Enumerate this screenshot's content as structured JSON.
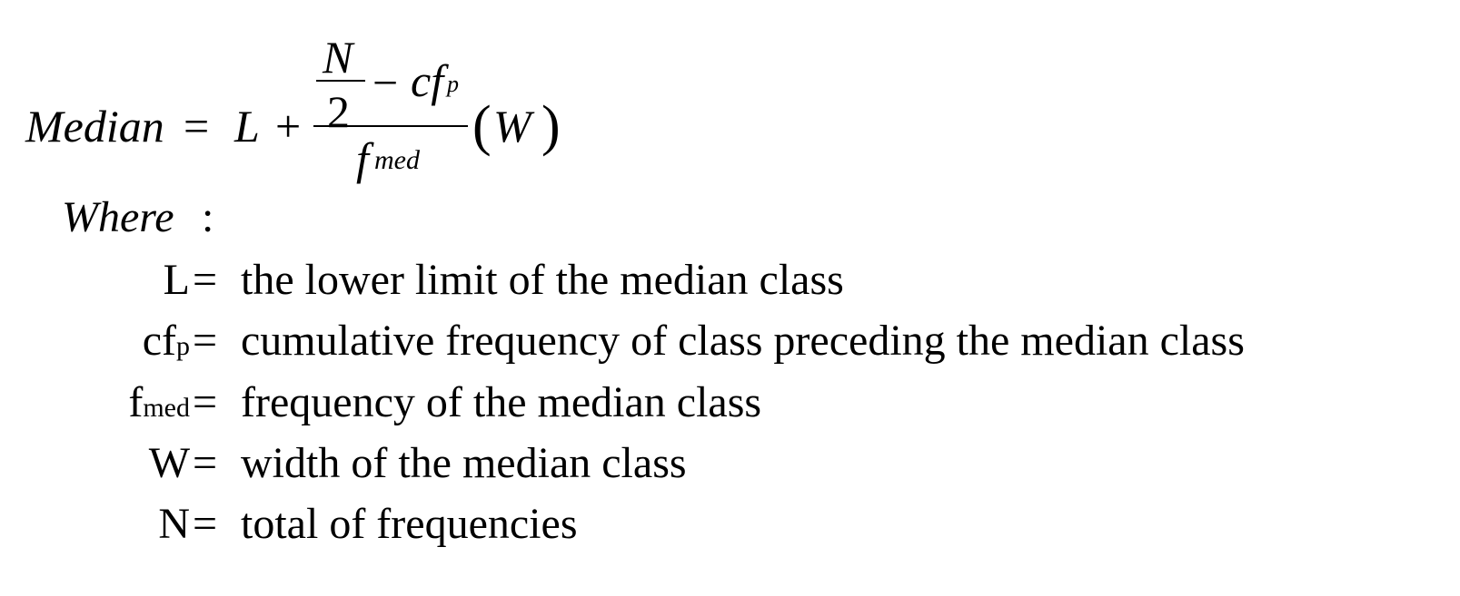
{
  "formula": {
    "lhs": "Median",
    "equals": "=",
    "L": "L",
    "plus": "+",
    "N": "N",
    "two": "2",
    "minus": "−",
    "cf": "cf",
    "cf_sub": "p",
    "f": "f",
    "f_sub": "med",
    "open_paren": "(",
    "W": "W",
    "close_paren": ")"
  },
  "where_label": "Where",
  "where_colon": ":",
  "definitions": [
    {
      "symbol": "L",
      "subscript": "",
      "equals": "=",
      "text": "the lower limit of the median class"
    },
    {
      "symbol": "cf",
      "subscript": "p",
      "equals": "=",
      "text": "cumulative frequency of class preceding the median class"
    },
    {
      "symbol": "f",
      "subscript": "med",
      "equals": "=",
      "text": "frequency of the median class"
    },
    {
      "symbol": "W",
      "subscript": "",
      "equals": "=",
      "text": "width of the median class"
    },
    {
      "symbol": "N",
      "subscript": "",
      "equals": "=",
      "text": "total of frequencies"
    }
  ]
}
